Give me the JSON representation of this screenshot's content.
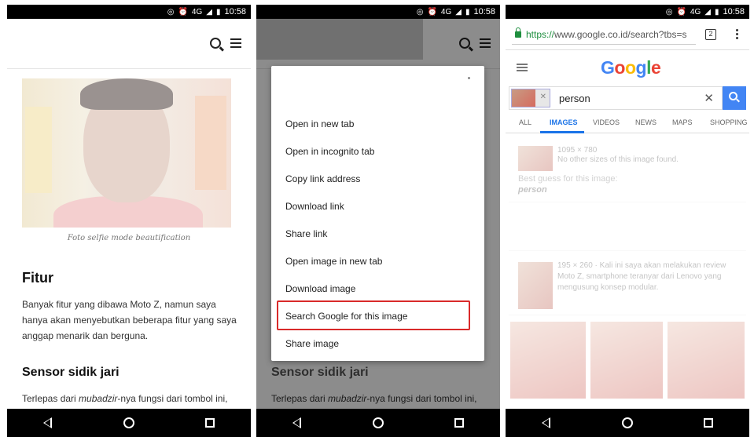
{
  "status": {
    "signal_label": "4G",
    "time": "10:58"
  },
  "panel1": {
    "caption": "Foto selfie mode beautification",
    "heading": "Fitur",
    "paragraph": "Banyak fitur yang dibawa Moto Z, namun saya hanya akan menyebutkan beberapa fitur yang saya anggap menarik dan berguna.",
    "subheading": "Sensor sidik jari",
    "para2_before": "Terlepas dari ",
    "para2_em": "mubadzir",
    "para2_after": "-nya fungsi dari tombol ini,"
  },
  "panel2": {
    "menu_items": [
      "Open in new tab",
      "Open in incognito tab",
      "Copy link address",
      "Download link",
      "Share link",
      "Open image in new tab",
      "Download image",
      "Search Google for this image",
      "Share image"
    ],
    "subheading": "Sensor sidik jari",
    "para2_before": "Terlepas dari ",
    "para2_em": "mubadzir",
    "para2_after": "-nya fungsi dari tombol ini,"
  },
  "panel3": {
    "url_https": "https://",
    "url_rest": "www.google.co.id/search?tbs=s",
    "tab_count": "2",
    "logo": {
      "G": "G",
      "o1": "o",
      "o2": "o",
      "g": "g",
      "l": "l",
      "e": "e"
    },
    "query": "person",
    "tabs": [
      "ALL",
      "IMAGES",
      "VIDEOS",
      "NEWS",
      "MAPS",
      "SHOPPING"
    ],
    "result1_size": "1095 × 780",
    "result1_note": "No other sizes of this image found.",
    "best_guess_label": "Best guess for this image:",
    "best_guess_value": "person",
    "result2_meta": "195 × 260 · Kali ini saya akan melakukan review Moto Z, smartphone teranyar dari Lenovo yang mengusung konsep modular."
  },
  "colors": {
    "google_blue": "#4285F4",
    "google_red": "#EA4335",
    "google_yellow": "#FBBC05",
    "google_green": "#34A853",
    "highlight_red": "#D92A2A"
  }
}
